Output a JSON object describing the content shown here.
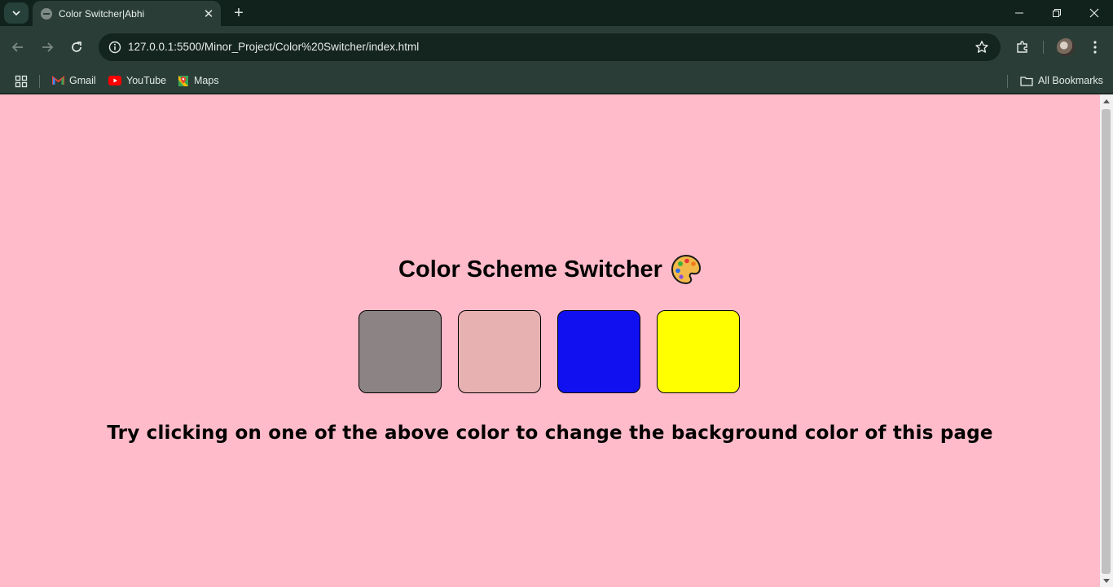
{
  "browser": {
    "tab": {
      "title": "Color Switcher|Abhi"
    },
    "address": {
      "url": "127.0.0.1:5500/Minor_Project/Color%20Switcher/index.html"
    },
    "bookmarks": {
      "items": [
        {
          "label": "Gmail",
          "icon": "gmail-icon"
        },
        {
          "label": "YouTube",
          "icon": "youtube-icon"
        },
        {
          "label": "Maps",
          "icon": "maps-icon"
        }
      ],
      "all_bookmarks_label": "All Bookmarks"
    }
  },
  "page": {
    "background_color": "#ffbbc9",
    "title": "Color Scheme Switcher",
    "title_emoji": "palette-icon",
    "swatches": [
      {
        "name": "grey",
        "color": "#8c8484"
      },
      {
        "name": "pink",
        "color": "#e8b1b1"
      },
      {
        "name": "blue",
        "color": "#1010f0"
      },
      {
        "name": "yellow",
        "color": "#ffff00"
      }
    ],
    "hint": "Try clicking on one of the above color to change the background color of this page"
  }
}
